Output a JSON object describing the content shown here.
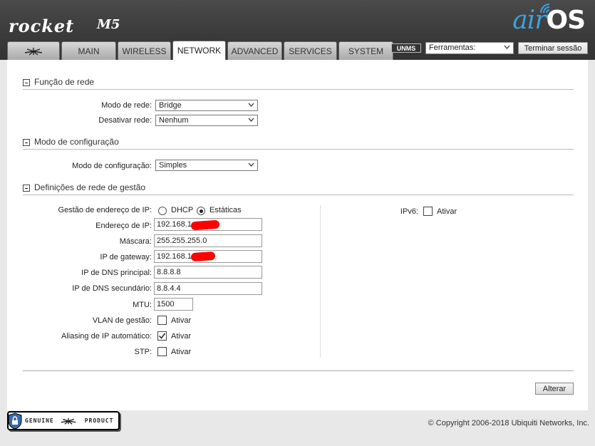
{
  "brand": {
    "product": "rocket",
    "model": "M5",
    "os_prefix": "air",
    "os_suffix": "OS"
  },
  "tabs": [
    {
      "label": "",
      "icon": "ubiquiti-logo-icon"
    },
    {
      "label": "MAIN"
    },
    {
      "label": "WIRELESS"
    },
    {
      "label": "NETWORK",
      "active": true
    },
    {
      "label": "ADVANCED"
    },
    {
      "label": "SERVICES"
    },
    {
      "label": "SYSTEM"
    }
  ],
  "topbar": {
    "unms_label": "UNMS",
    "tools_value": "Ferramentas:",
    "logout_label": "Terminar sessão"
  },
  "sections": {
    "network_role": {
      "title": "Função de rede",
      "mode_label": "Modo de rede:",
      "mode_value": "Bridge",
      "disable_label": "Desativar rede:",
      "disable_value": "Nenhum"
    },
    "config_mode": {
      "title": "Modo de configuração",
      "mode_label": "Modo de configuração:",
      "mode_value": "Simples"
    },
    "management": {
      "title": "Definições de rede de gestão",
      "ip_mgmt_label": "Gestão de endereço de IP:",
      "dhcp_label": "DHCP",
      "static_label": "Estáticas",
      "selected": "Estáticas",
      "ip_label": "Endereço de IP:",
      "ip_value": "192.168.1",
      "mask_label": "Máscara:",
      "mask_value": "255.255.255.0",
      "gateway_label": "IP de gateway:",
      "gateway_value": "192.168.1",
      "dns1_label": "IP de DNS principal:",
      "dns1_value": "8.8.8.8",
      "dns2_label": "IP de DNS secundário:",
      "dns2_value": "8.8.4.4",
      "mtu_label": "MTU:",
      "mtu_value": "1500",
      "vlan_label": "VLAN de gestão:",
      "vlan_option": "Ativar",
      "vlan_checked": false,
      "alias_label": "Aliasing de IP automático:",
      "alias_option": "Ativar",
      "alias_checked": true,
      "stp_label": "STP:",
      "stp_option": "Ativar",
      "stp_checked": false,
      "ipv6_label": "IPv6:",
      "ipv6_option": "Ativar",
      "ipv6_checked": false
    }
  },
  "actions": {
    "apply_label": "Alterar"
  },
  "footer": {
    "genuine_left": "GENUINE",
    "genuine_right": "PRODUCT",
    "copyright": "© Copyright 2006-2018 Ubiquiti Networks, Inc."
  },
  "colors": {
    "header_bg": "#3a3a3a",
    "air_blue": "#3aa2e0",
    "redaction": "#ff0000"
  }
}
